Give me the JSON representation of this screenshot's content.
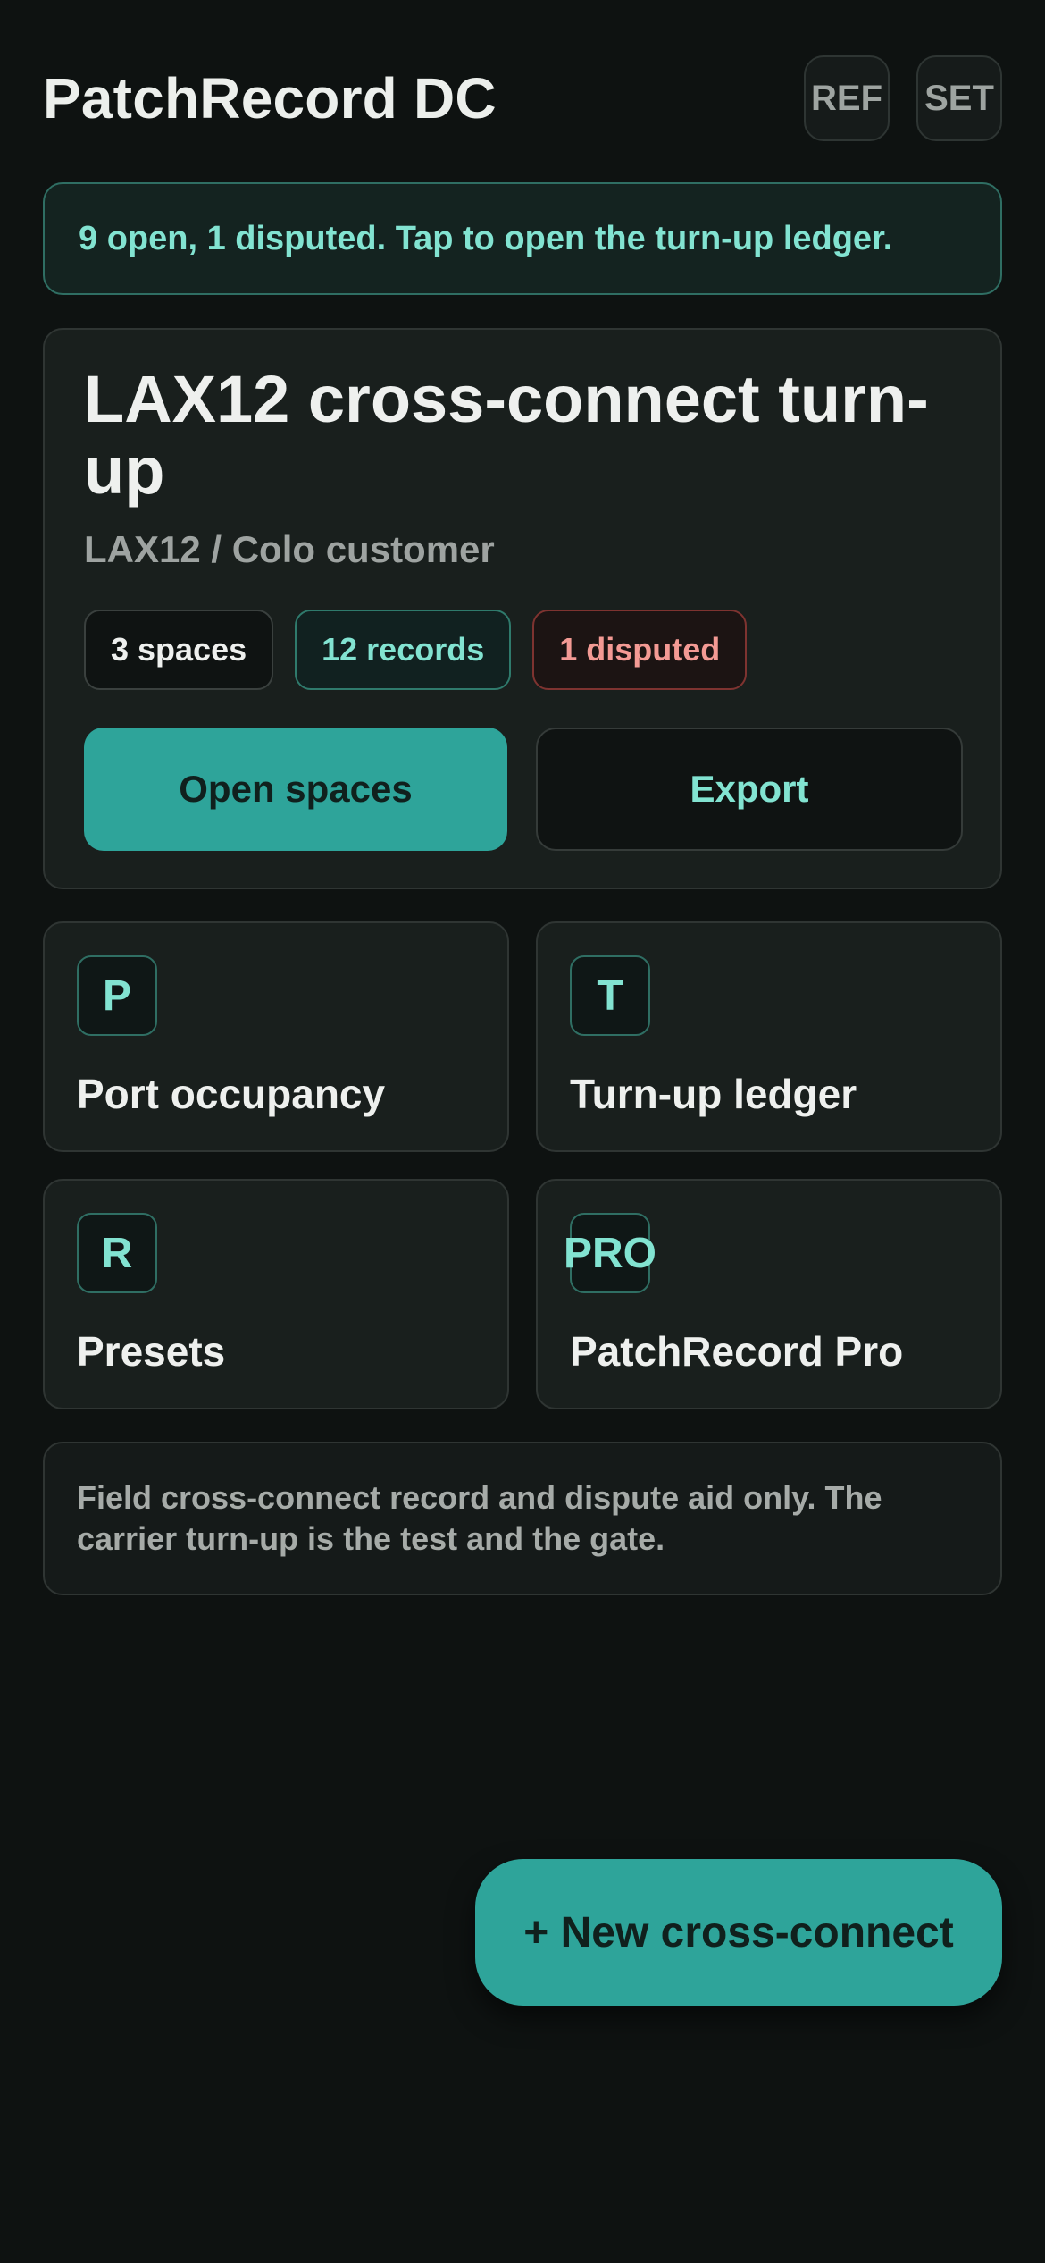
{
  "header": {
    "title": "PatchRecord DC",
    "ref_label": "REF",
    "set_label": "SET"
  },
  "banner": {
    "text": "9 open, 1 disputed. Tap to open the turn-up ledger."
  },
  "hero": {
    "title": "LAX12 cross-connect turn-up",
    "subtitle": "LAX12 / Colo customer",
    "pills": {
      "spaces": "3 spaces",
      "records": "12 records",
      "disputed": "1 disputed"
    },
    "primary_label": "Open spaces",
    "secondary_label": "Export"
  },
  "tiles": [
    {
      "badge": "P",
      "label": "Port occupancy"
    },
    {
      "badge": "T",
      "label": "Turn-up ledger"
    },
    {
      "badge": "R",
      "label": "Presets"
    },
    {
      "badge": "PRO",
      "label": "PatchRecord Pro"
    }
  ],
  "disclaimer": "Field cross-connect record and dispute aid only. The carrier turn-up is the test and the gate.",
  "fab": {
    "label": "+ New cross-connect"
  },
  "colors": {
    "background": "#0e1211",
    "accent": "#2ea49a",
    "accent_text": "#82e3d1",
    "danger_text": "#f39a94",
    "card": "#191f1d"
  }
}
